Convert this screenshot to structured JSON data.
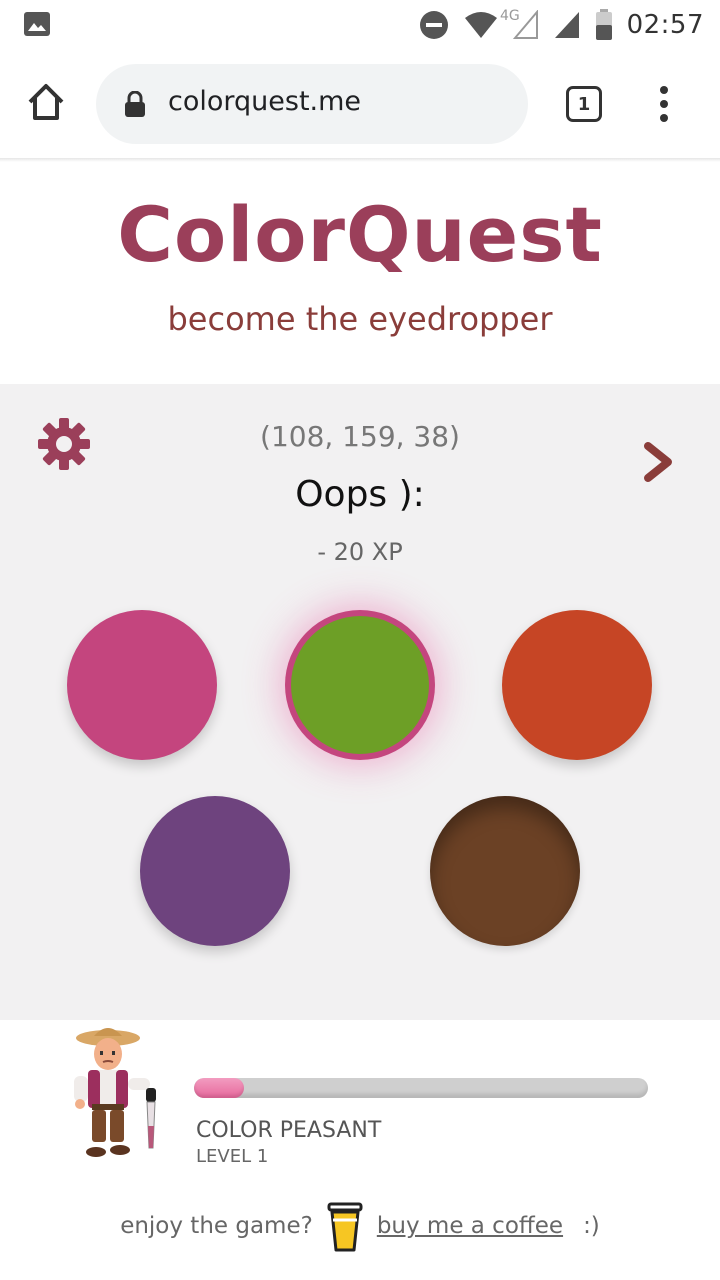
{
  "status_bar": {
    "time": "02:57",
    "network_label": "4G"
  },
  "browser": {
    "url": "colorquest.me",
    "tab_count": "1"
  },
  "header": {
    "title": "ColorQuest",
    "subtitle": "become the eyedropper"
  },
  "game": {
    "target_rgb": "(108, 159, 38)",
    "result": "Oops ):",
    "xp_change": "- 20 XP",
    "swatches": [
      {
        "color": "#c4457e",
        "state": "normal"
      },
      {
        "color": "#6d9f26",
        "state": "selected"
      },
      {
        "color": "#c64525",
        "state": "normal"
      },
      {
        "color": "#6e437e",
        "state": "normal"
      },
      {
        "color": "#6b4125",
        "state": "pressed"
      }
    ],
    "accent_color": "#9b3f5a"
  },
  "player": {
    "rank": "COLOR PEASANT",
    "level": "LEVEL 1",
    "xp_progress": 0.11
  },
  "footer": {
    "prompt": "enjoy the game?",
    "link": "buy me a coffee",
    "smile": ":)"
  }
}
